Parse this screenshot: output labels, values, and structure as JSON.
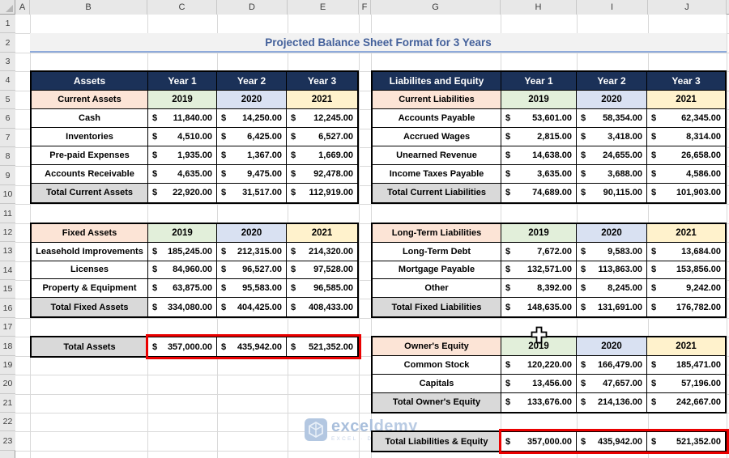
{
  "sheet": {
    "title": "Projected Balance Sheet Format for 3 Years",
    "column_letters": [
      "A",
      "B",
      "C",
      "D",
      "E",
      "F",
      "G",
      "H",
      "I",
      "J"
    ],
    "row_numbers": [
      "1",
      "2",
      "3",
      "4",
      "5",
      "6",
      "7",
      "8",
      "9",
      "10",
      "11",
      "12",
      "13",
      "14",
      "15",
      "16",
      "17",
      "18",
      "19",
      "20",
      "21",
      "22",
      "23"
    ]
  },
  "currency": "$",
  "colors": {
    "header_navy": "#1B3158",
    "subheader_pink": "#FCE4D6",
    "year_colors": [
      "#E2EFDA",
      "#D9E1F2",
      "#FFF2CC"
    ],
    "total_gray": "#D9D9D9",
    "highlight_red": "#EB0000",
    "title_blue": "#44619B",
    "title_underline": "#8EAADB"
  },
  "tables": [
    {
      "name": "assets-current",
      "rows": [
        {
          "kind": "head",
          "label": "Assets",
          "values": [
            "Year 1",
            "Year 2",
            "Year 3"
          ]
        },
        {
          "kind": "sub",
          "label": "Current Assets",
          "values": [
            "2019",
            "2020",
            "2021"
          ]
        },
        {
          "kind": "data",
          "label": "Cash",
          "values": [
            "11,840.00",
            "14,250.00",
            "12,245.00"
          ]
        },
        {
          "kind": "data",
          "label": "Inventories",
          "values": [
            "4,510.00",
            "6,425.00",
            "6,527.00"
          ]
        },
        {
          "kind": "data",
          "label": "Pre-paid Expenses",
          "values": [
            "1,935.00",
            "1,367.00",
            "1,669.00"
          ]
        },
        {
          "kind": "data",
          "label": "Accounts Receivable",
          "values": [
            "4,635.00",
            "9,475.00",
            "92,478.00"
          ]
        },
        {
          "kind": "total",
          "label": "Total Current Assets",
          "values": [
            "22,920.00",
            "31,517.00",
            "112,919.00"
          ]
        }
      ]
    },
    {
      "name": "assets-fixed",
      "rows": [
        {
          "kind": "sub",
          "label": "Fixed Assets",
          "values": [
            "2019",
            "2020",
            "2021"
          ]
        },
        {
          "kind": "data",
          "label": "Leasehold Improvements",
          "values": [
            "185,245.00",
            "212,315.00",
            "214,320.00"
          ]
        },
        {
          "kind": "data",
          "label": "Licenses",
          "values": [
            "84,960.00",
            "96,527.00",
            "97,528.00"
          ]
        },
        {
          "kind": "data",
          "label": "Property & Equipment",
          "values": [
            "63,875.00",
            "95,583.00",
            "96,585.00"
          ]
        },
        {
          "kind": "total",
          "label": "Total Fixed Assets",
          "values": [
            "334,080.00",
            "404,425.00",
            "408,433.00"
          ]
        }
      ]
    },
    {
      "name": "total-assets",
      "highlight": true,
      "rows": [
        {
          "kind": "total",
          "label": "Total Assets",
          "values": [
            "357,000.00",
            "435,942.00",
            "521,352.00"
          ]
        }
      ]
    },
    {
      "name": "liabilities-current",
      "rows": [
        {
          "kind": "head",
          "label": "Liabilites and Equity",
          "values": [
            "Year 1",
            "Year 2",
            "Year 3"
          ]
        },
        {
          "kind": "sub",
          "label": "Current Liabilities",
          "values": [
            "2019",
            "2020",
            "2021"
          ]
        },
        {
          "kind": "data",
          "label": "Accounts Payable",
          "values": [
            "53,601.00",
            "58,354.00",
            "62,345.00"
          ]
        },
        {
          "kind": "data",
          "label": "Accrued Wages",
          "values": [
            "2,815.00",
            "3,418.00",
            "8,314.00"
          ]
        },
        {
          "kind": "data",
          "label": "Unearned Revenue",
          "values": [
            "14,638.00",
            "24,655.00",
            "26,658.00"
          ]
        },
        {
          "kind": "data",
          "label": "Income Taxes Payable",
          "values": [
            "3,635.00",
            "3,688.00",
            "4,586.00"
          ]
        },
        {
          "kind": "total",
          "label": "Total Current Liabilities",
          "values": [
            "74,689.00",
            "90,115.00",
            "101,903.00"
          ]
        }
      ]
    },
    {
      "name": "liabilities-longterm",
      "rows": [
        {
          "kind": "sub",
          "label": "Long-Term Liabilities",
          "values": [
            "2019",
            "2020",
            "2021"
          ]
        },
        {
          "kind": "data",
          "label": "Long-Term Debt",
          "values": [
            "7,672.00",
            "9,583.00",
            "13,684.00"
          ]
        },
        {
          "kind": "data",
          "label": "Mortgage Payable",
          "values": [
            "132,571.00",
            "113,863.00",
            "153,856.00"
          ]
        },
        {
          "kind": "data",
          "label": "Other",
          "values": [
            "8,392.00",
            "8,245.00",
            "9,242.00"
          ]
        },
        {
          "kind": "total",
          "label": "Total Fixed Liabilities",
          "values": [
            "148,635.00",
            "131,691.00",
            "176,782.00"
          ]
        }
      ]
    },
    {
      "name": "owners-equity",
      "rows": [
        {
          "kind": "sub",
          "label": "Owner's Equity",
          "values": [
            "2019",
            "2020",
            "2021"
          ]
        },
        {
          "kind": "data",
          "label": "Common Stock",
          "values": [
            "120,220.00",
            "166,479.00",
            "185,471.00"
          ]
        },
        {
          "kind": "data",
          "label": "Capitals",
          "values": [
            "13,456.00",
            "47,657.00",
            "57,196.00"
          ]
        },
        {
          "kind": "total",
          "label": "Total Owner's Equity",
          "values": [
            "133,676.00",
            "214,136.00",
            "242,667.00"
          ]
        }
      ]
    },
    {
      "name": "total-liabilities-equity",
      "highlight": true,
      "rows": [
        {
          "kind": "total",
          "label": "Total Liabilities & Equity",
          "values": [
            "357,000.00",
            "435,942.00",
            "521,352.00"
          ]
        }
      ]
    }
  ],
  "watermark": {
    "brand_part1": "excel",
    "brand_part2": "demy",
    "tagline": "EXCEL · DATA BI"
  },
  "icons": {
    "cursor": "excel-plus-cell-cursor",
    "watermark_logo": "exceldemy-cube-logo",
    "select_all_corner": "select-all-triangle"
  }
}
